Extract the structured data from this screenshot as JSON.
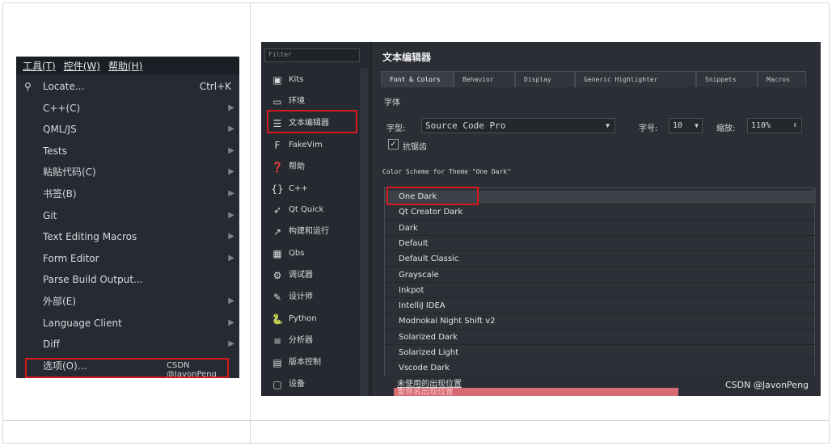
{
  "menubar": {
    "tools": "工具(T)",
    "controls": "控件(W)",
    "help": "帮助(H)"
  },
  "tools_menu": [
    {
      "label": "Locate...",
      "shortcut": "Ctrl+K"
    },
    {
      "label": "C++(C)"
    },
    {
      "label": "QML/JS"
    },
    {
      "label": "Tests"
    },
    {
      "label": "粘贴代码(C)"
    },
    {
      "label": "书签(B)"
    },
    {
      "label": "Git"
    },
    {
      "label": "Text Editing Macros"
    },
    {
      "label": "Form Editor"
    },
    {
      "label": "Parse Build Output..."
    },
    {
      "label": "外部(E)"
    },
    {
      "label": "Language Client"
    },
    {
      "label": "Diff"
    },
    {
      "label": "选项(O)..."
    }
  ],
  "watermark": "CSDN @JavonPeng",
  "options": {
    "filter": "Filter",
    "sidebar": [
      "Kits",
      "环境",
      "文本编辑器",
      "FakeVim",
      "帮助",
      "C++",
      "Qt Quick",
      "构建和运行",
      "Qbs",
      "调试器",
      "设计师",
      "Python",
      "分析器",
      "版本控制",
      "设备"
    ],
    "title": "文本编辑器",
    "tabs": [
      "Font & Colors",
      "Behavior",
      "Display",
      "Generic Highlighter",
      "Snippets",
      "Macros"
    ],
    "font_section": "字体",
    "font_label": "字型:",
    "font_value": "Source Code Pro",
    "size_label": "字号:",
    "size_value": "10",
    "zoom_label": "缩放:",
    "zoom_value": "110%",
    "antialias": "抗锯齿",
    "scheme_label": "Color Scheme for Theme \"One Dark\"",
    "schemes": [
      "One Dark",
      "Qt Creator Dark",
      "Dark",
      "Default",
      "Default Classic",
      "Grayscale",
      "Inkpot",
      "IntelliJ IDEA",
      "Modnokai Night Shift v2",
      "Solarized Dark",
      "Solarized Light",
      "Vscode Dark"
    ],
    "under1": "未使用的出现位置",
    "under2": "重命名出现位置",
    "watermark": "CSDN @JavonPeng"
  }
}
